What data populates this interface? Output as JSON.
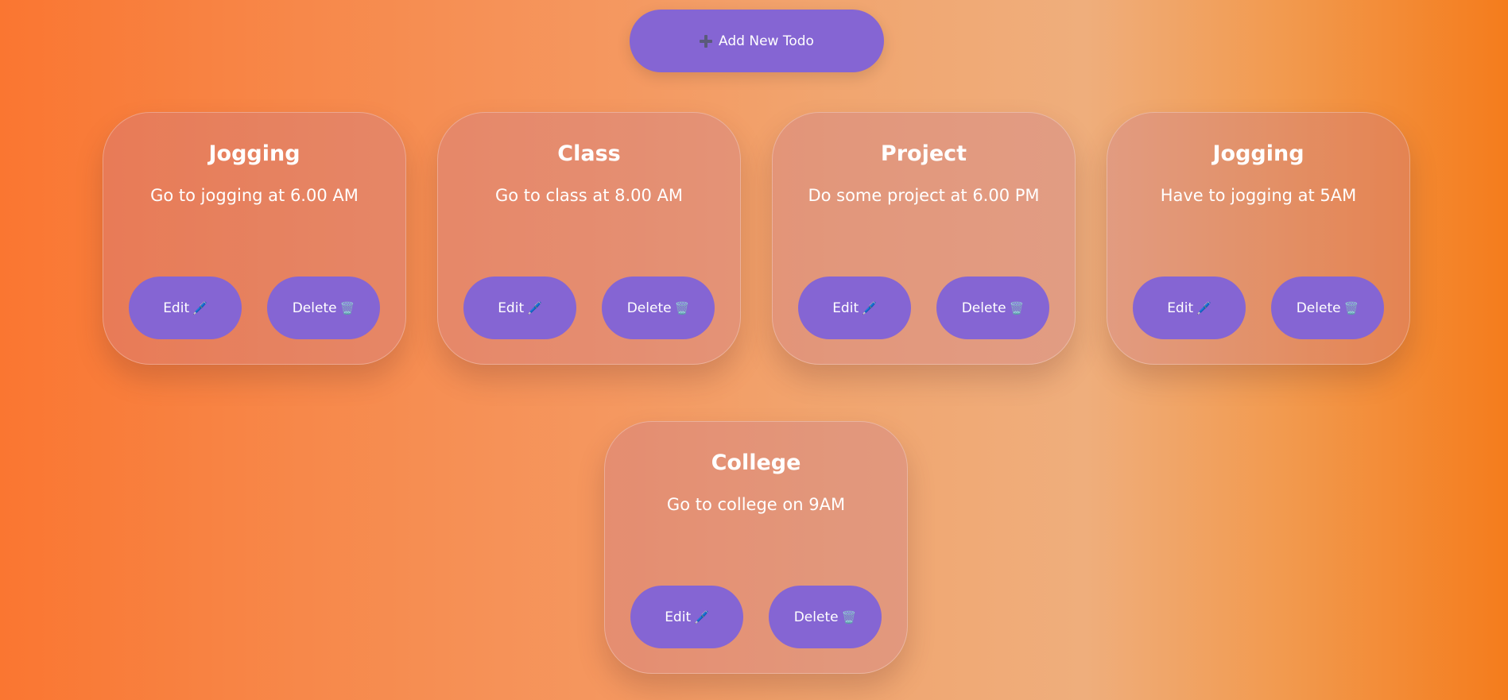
{
  "header": {
    "add_button_label": "Add New Todo",
    "add_icon": "plus-icon"
  },
  "todos": [
    {
      "title": "Jogging",
      "description": "Go to jogging at 6.00 AM",
      "edit_label": "Edit",
      "delete_label": "Delete"
    },
    {
      "title": "Class",
      "description": "Go to class at 8.00 AM",
      "edit_label": "Edit",
      "delete_label": "Delete"
    },
    {
      "title": "Project",
      "description": "Do some project at 6.00 PM",
      "edit_label": "Edit",
      "delete_label": "Delete"
    },
    {
      "title": "Jogging",
      "description": "Have to jogging at 5AM",
      "edit_label": "Edit",
      "delete_label": "Delete"
    },
    {
      "title": "College",
      "description": "Go to college on 9AM",
      "edit_label": "Edit",
      "delete_label": "Delete"
    }
  ],
  "icons": {
    "edit": "🖊️",
    "delete": "🗑️"
  },
  "colors": {
    "button": "#8565d3",
    "background_start": "#fa7631",
    "background_end": "#f47c1c"
  }
}
